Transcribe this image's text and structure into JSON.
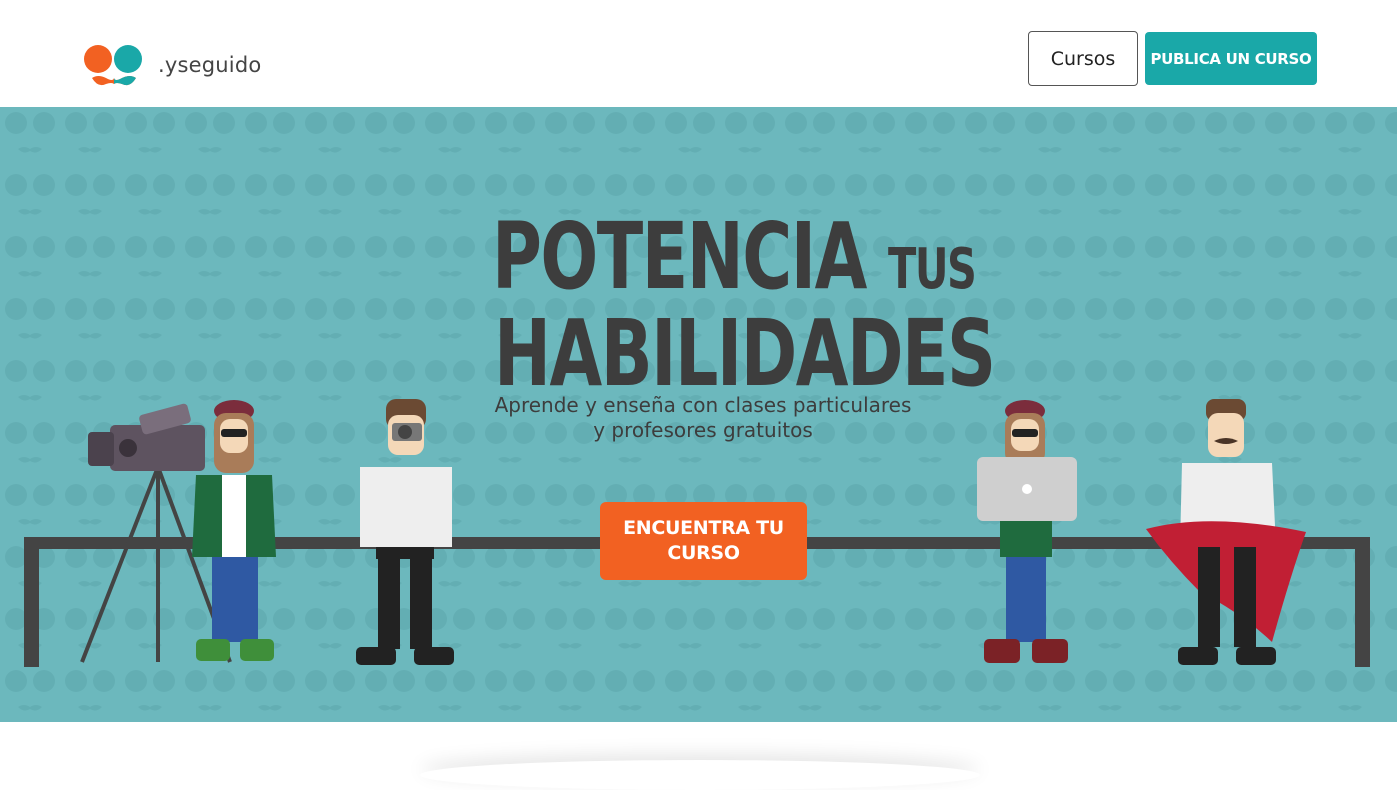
{
  "header": {
    "brand_name": ".yseguido",
    "nav_courses_label": "Cursos",
    "publish_button_label": "PUBLICA UN CURSO"
  },
  "hero": {
    "headline_line1_big": "POTENCIA",
    "headline_line1_small": "TUS",
    "headline_line2": "HABILIDADES",
    "subtitle_line1": "Aprende y enseña con clases particulares",
    "subtitle_line2": "y profesores gratuitos",
    "cta_label": "ENCUENTRA TU CURSO"
  },
  "colors": {
    "brand_orange": "#f26122",
    "brand_teal": "#1aa8a8",
    "hero_background": "#6cb8bd",
    "text_dark": "#3d3d3d"
  }
}
